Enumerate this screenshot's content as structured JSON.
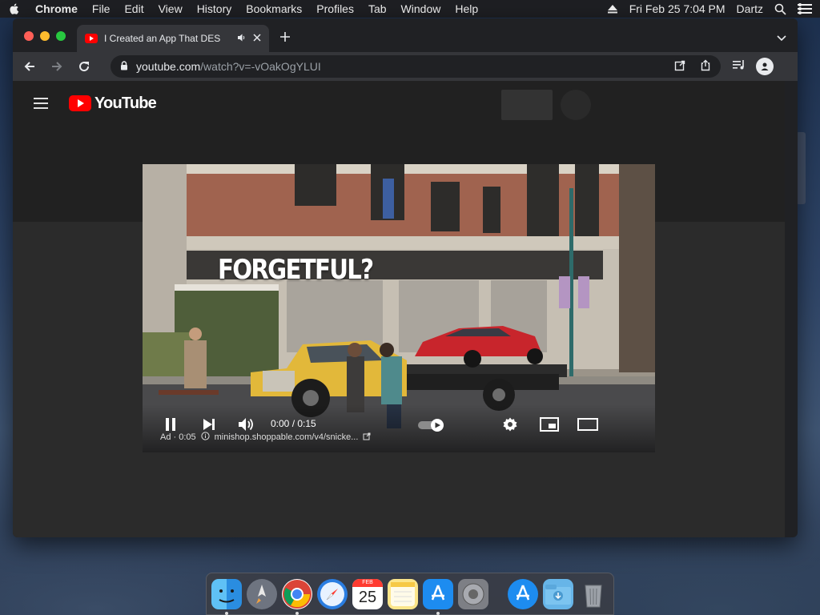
{
  "menubar": {
    "app": "Chrome",
    "items": [
      "File",
      "Edit",
      "View",
      "History",
      "Bookmarks",
      "Profiles",
      "Tab",
      "Window",
      "Help"
    ],
    "datetime": "Fri Feb 25  7:04 PM",
    "user": "Dartz"
  },
  "browser": {
    "tab_title": "I Created an App That DES",
    "url_host": "youtube.com",
    "url_path": "/watch?v=-vOakOgYLUI"
  },
  "youtube": {
    "logo_text": "YouTube"
  },
  "video": {
    "overlay_text": "FORGETFUL?",
    "time": "0:00 / 0:15",
    "ad_label": "Ad · 0:05",
    "ad_link": "minishop.shoppable.com/v4/snicke..."
  },
  "dock": {
    "calendar_month": "FEB",
    "calendar_day": "25"
  },
  "colors": {
    "youtube_red": "#ff0000",
    "chrome_dark": "#202124",
    "toolbar": "#35363a"
  }
}
